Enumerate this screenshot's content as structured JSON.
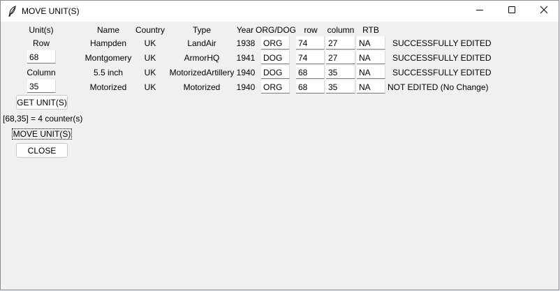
{
  "window": {
    "title": "MOVE UNIT(S)",
    "icon": "feather-icon",
    "controls": {
      "minimize": "minimize-icon",
      "maximize": "maximize-icon",
      "close": "close-icon"
    }
  },
  "left_panel": {
    "units_label": "Unit(s)",
    "row_label": "Row",
    "row_value": "68",
    "column_label": "Column",
    "column_value": "35",
    "get_button": "GET UNIT(S)",
    "count_text": "[68,35] = 4 counter(s)",
    "move_button": "MOVE UNIT(S)",
    "close_button": "CLOSE"
  },
  "table": {
    "headers": {
      "name": "Name",
      "country": "Country",
      "type": "Type",
      "year": "Year",
      "orgdog": "ORG/DOG",
      "row": "row",
      "column": "column",
      "rtb": "RTB"
    },
    "rows": [
      {
        "name": "Hampden",
        "country": "UK",
        "type": "LandAir",
        "year": "1938",
        "orgdog": "ORG",
        "row": "74",
        "column": "27",
        "rtb": "NA",
        "status": "SUCCESSFULLY EDITED"
      },
      {
        "name": "Montgomery",
        "country": "UK",
        "type": "ArmorHQ",
        "year": "1941",
        "orgdog": "DOG",
        "row": "74",
        "column": "27",
        "rtb": "NA",
        "status": "SUCCESSFULLY EDITED"
      },
      {
        "name": "5.5 inch",
        "country": "UK",
        "type": "MotorizedArtillery",
        "year": "1940",
        "orgdog": "DOG",
        "row": "68",
        "column": "35",
        "rtb": "NA",
        "status": "SUCCESSFULLY EDITED"
      },
      {
        "name": "Motorized",
        "country": "UK",
        "type": "Motorized",
        "year": "1940",
        "orgdog": "ORG",
        "row": "68",
        "column": "35",
        "rtb": "NA",
        "status": "NOT EDITED (No Change)"
      }
    ]
  }
}
